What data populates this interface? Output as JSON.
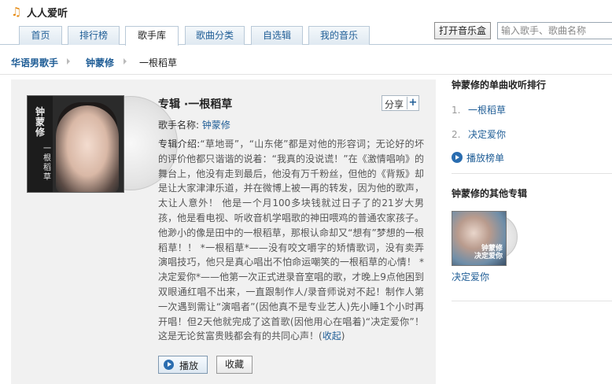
{
  "app": {
    "title": "人人爱听",
    "logo_icon": "music-note-icon",
    "logo_glyph": "♫"
  },
  "nav": {
    "tabs": [
      {
        "label": "首页",
        "active": false
      },
      {
        "label": "排行榜",
        "active": false
      },
      {
        "label": "歌手库",
        "active": true
      },
      {
        "label": "歌曲分类",
        "active": false
      },
      {
        "label": "自选辑",
        "active": false
      },
      {
        "label": "我的音乐",
        "active": false
      }
    ],
    "open_musicbox_label": "打开音乐盒",
    "search_placeholder": "输入歌手、歌曲名称"
  },
  "breadcrumb": {
    "items": [
      "华语男歌手",
      "钟蒙修",
      "一根稻草"
    ]
  },
  "album": {
    "title": "专辑 ·一根稻草",
    "share_label": "分享",
    "share_plus": "+",
    "singer_label": "歌手名称:",
    "singer_name": "钟蒙修",
    "cover_text_left": "钟蒙修",
    "cover_text_right": "一根稻草",
    "intro_label": "专辑介绍:",
    "intro_text": "“草地哥”，“山东佬”都是对他的形容词；无论好的坏的评价他都只谐谐的说着：“我真的没说谎！”在《激情唱响》的舞台上，他没有走到最后，他没有万千粉丝，但他的《背叛》却是让大家津津乐道，并在微博上被一再的转发，因为他的歌声，太让人意外！ 他是一个月100多块钱就过日子了的21岁大男孩，他是看电视、听收音机学唱歌的神田喂鸡的普通农家孩子。他渺小的像是田中的一根稻草，那根认命却又“想有”梦想的一根稻草！！ *一根稻草*——没有咬文嚼字的矫情歌词，没有卖弄演唱技巧，他只是真心唱出不怕命运嘲笑的一根稻草的心情！ *决定爱你*——他第一次正式进录音室唱的歌，才晚上9点他困到双眼通红唱不出来，一直跟制作人/录音师说对不起！制作人第一次遇到需让“演唱者”(因他真不是专业艺人)先小睡1个小时再开唱！但2天他就完成了这首歌(因他用心在唱着)“决定爱你”！这是无论贫富贵贱都会有的共同心声！",
    "collapse_label": "收起",
    "play_label": "播放",
    "favorite_label": "收藏"
  },
  "sidebar": {
    "ranking_title": "钟蒙修的单曲收听排行",
    "ranking": [
      {
        "num": "1.",
        "song": "一根稻草"
      },
      {
        "num": "2.",
        "song": "决定爱你"
      }
    ],
    "playlist_label": "播放榜单",
    "other_albums_title": "钟蒙修的其他专辑",
    "other_albums": [
      {
        "name": "决定爱你",
        "cover_text_1": "钟蒙修",
        "cover_text_2": "决定爱你"
      }
    ]
  }
}
